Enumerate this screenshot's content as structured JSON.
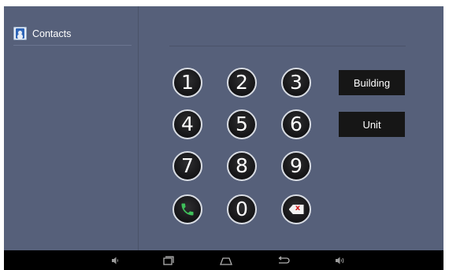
{
  "sidebar": {
    "contacts_label": "Contacts",
    "contacts_icon": "contacts-icon"
  },
  "dialpad": {
    "keys": [
      "1",
      "2",
      "3",
      "4",
      "5",
      "6",
      "7",
      "8",
      "9",
      "0"
    ],
    "call_icon": "phone-icon",
    "delete_icon": "backspace-icon",
    "delete_glyph": "x",
    "call_color": "#3fc05a"
  },
  "buttons": {
    "building": "Building",
    "unit": "Unit"
  },
  "navbar": {
    "icons": [
      "volume-down-icon",
      "recent-apps-icon",
      "home-icon",
      "back-icon",
      "volume-up-icon"
    ]
  },
  "colors": {
    "background": "#56607a",
    "navbar": "#000000",
    "button": "#161616"
  }
}
